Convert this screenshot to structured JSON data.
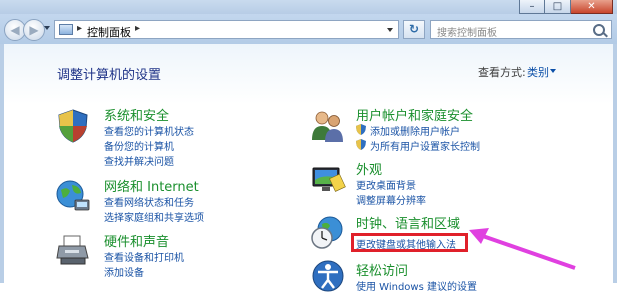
{
  "window": {
    "minimize_glyph": "–",
    "maximize_glyph": "□",
    "close_glyph": "✕"
  },
  "toolbar": {
    "back_glyph": "◀",
    "forward_glyph": "▶",
    "address_separator": "▸",
    "address_crumb": "控制面板",
    "address_trailing_separator": "▸",
    "refresh_glyph": "↻",
    "search_placeholder": "搜索控制面板"
  },
  "header": {
    "title": "调整计算机的设置",
    "view_by_label": "查看方式:",
    "view_by_value": "类别"
  },
  "categories": [
    {
      "title": "系统和安全",
      "icon": "shield-security-icon",
      "links": [
        "查看您的计算机状态",
        "备份您的计算机",
        "查找并解决问题"
      ]
    },
    {
      "title": "网络和 Internet",
      "icon": "network-globe-icon",
      "links": [
        "查看网络状态和任务",
        "选择家庭组和共享选项"
      ]
    },
    {
      "title": "硬件和声音",
      "icon": "printer-hardware-icon",
      "links": [
        "查看设备和打印机",
        "添加设备"
      ]
    },
    {
      "title": "用户帐户和家庭安全",
      "icon": "users-icon",
      "links": [
        "添加或删除用户帐户",
        "为所有用户设置家长控制"
      ]
    },
    {
      "title": "外观",
      "icon": "monitor-appearance-icon",
      "links": [
        "更改桌面背景",
        "调整屏幕分辨率"
      ]
    },
    {
      "title": "时钟、语言和区域",
      "icon": "clock-globe-icon",
      "links": [
        "更改键盘或其他输入法"
      ]
    },
    {
      "title": "轻松访问",
      "icon": "ease-of-access-icon",
      "links": [
        "使用 Windows 建议的设置"
      ]
    }
  ],
  "annotation": {
    "highlight_color": "#e0202a",
    "arrow_color": "#e040e0"
  }
}
